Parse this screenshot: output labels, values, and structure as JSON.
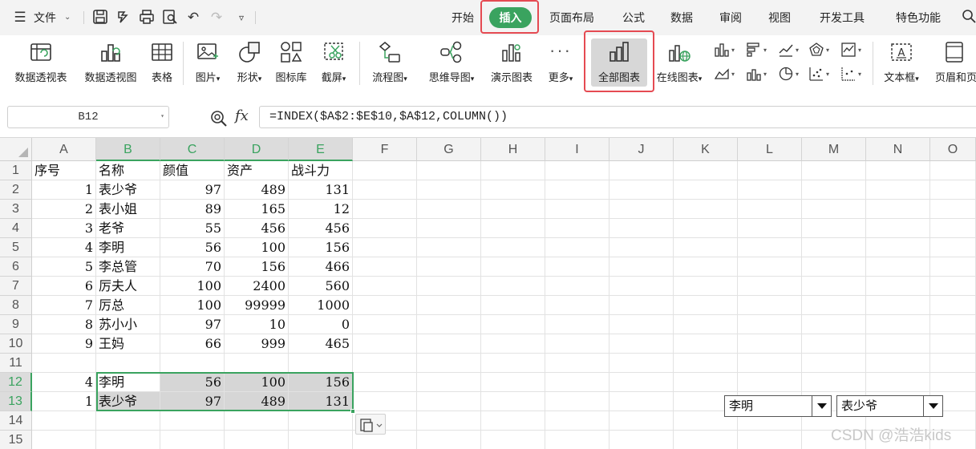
{
  "menubar": {
    "file_label": "文件",
    "tabs": [
      {
        "label": "开始"
      },
      {
        "label": "插入"
      },
      {
        "label": "页面布局"
      },
      {
        "label": "公式"
      },
      {
        "label": "数据"
      },
      {
        "label": "审阅"
      },
      {
        "label": "视图"
      },
      {
        "label": "开发工具"
      },
      {
        "label": "特色功能"
      }
    ],
    "active_tab": "插入",
    "accent_color": "#3aa35f",
    "highlight_color": "#e54a52"
  },
  "ribbon": {
    "pivot_table": "数据透视表",
    "pivot_chart": "数据透视图",
    "table": "表格",
    "picture": "图片",
    "shape": "形状",
    "icon_library": "图标库",
    "screenshot": "截屏",
    "flowchart": "流程图",
    "mindmap": "思维导图",
    "demo_chart": "演示图表",
    "more": "更多",
    "all_charts": "全部图表",
    "online_chart": "在线图表",
    "textbox": "文本框",
    "header_footer": "页眉和页"
  },
  "formula_bar": {
    "name_box": "B12",
    "fx_label": "fx",
    "formula": "=INDEX($A$2:$E$10,$A$12,COLUMN())"
  },
  "sheet": {
    "columns": [
      "A",
      "B",
      "C",
      "D",
      "E",
      "F",
      "G",
      "H",
      "I",
      "J",
      "K",
      "L",
      "M",
      "N",
      "O"
    ],
    "row_numbers": [
      "1",
      "2",
      "3",
      "4",
      "5",
      "6",
      "7",
      "8",
      "9",
      "10",
      "11",
      "12",
      "13",
      "14",
      "15"
    ],
    "header_row": [
      "序号",
      "名称",
      "颜值",
      "资产",
      "战斗力"
    ],
    "rows": [
      [
        "1",
        "表少爷",
        "97",
        "489",
        "131"
      ],
      [
        "2",
        "表小姐",
        "89",
        "165",
        "12"
      ],
      [
        "3",
        "老爷",
        "55",
        "456",
        "456"
      ],
      [
        "4",
        "李明",
        "56",
        "100",
        "156"
      ],
      [
        "5",
        "李总管",
        "70",
        "156",
        "466"
      ],
      [
        "6",
        "厉夫人",
        "100",
        "2400",
        "560"
      ],
      [
        "7",
        "厉总",
        "100",
        "99999",
        "1000"
      ],
      [
        "8",
        "苏小小",
        "97",
        "10",
        "0"
      ],
      [
        "9",
        "王妈",
        "66",
        "999",
        "465"
      ]
    ],
    "lookup_rows": [
      [
        "4",
        "李明",
        "56",
        "100",
        "156"
      ],
      [
        "1",
        "表少爷",
        "97",
        "489",
        "131"
      ]
    ],
    "dropdowns": [
      {
        "value": "李明"
      },
      {
        "value": "表少爷"
      }
    ]
  },
  "watermark": "CSDN @浩浩kids"
}
